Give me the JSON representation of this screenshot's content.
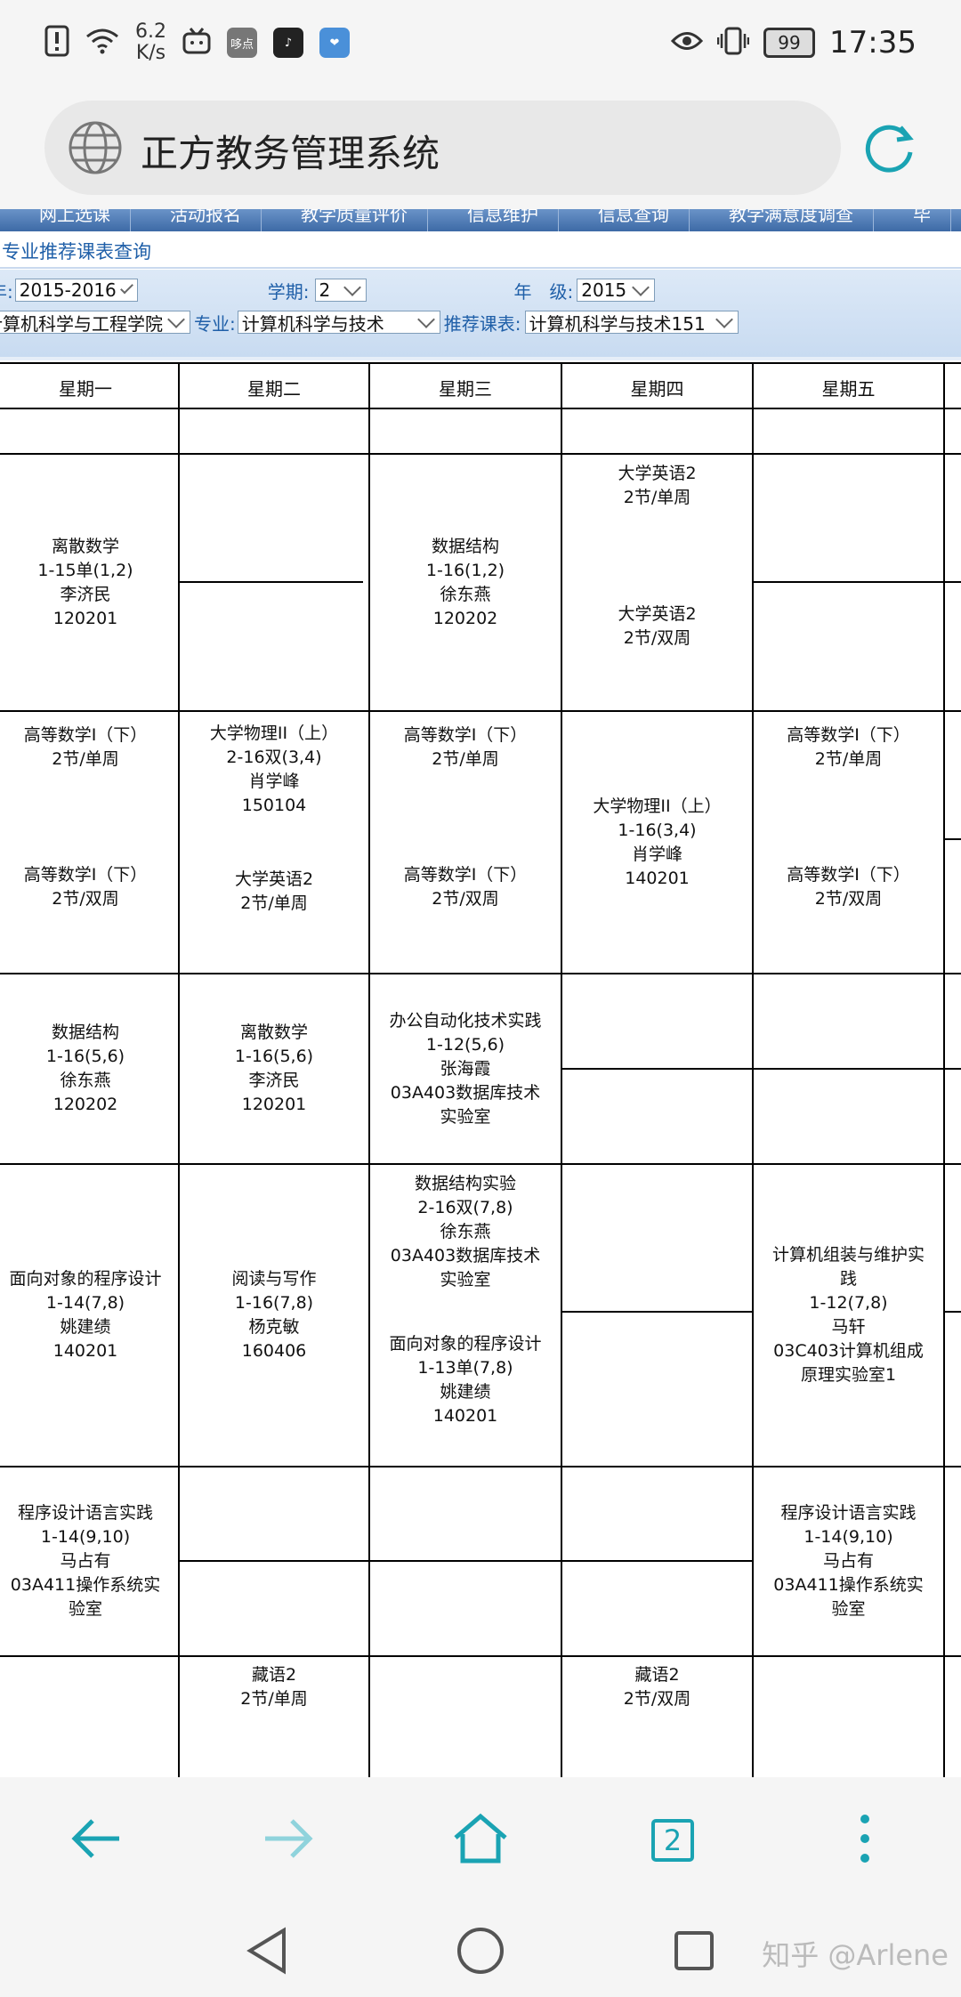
{
  "status_bar": {
    "net_speed_value": "6.2",
    "net_speed_unit": "K/s",
    "battery": "99",
    "time": "17:35",
    "app_icon_label": "哆点"
  },
  "browser": {
    "title": "正方教务管理系统",
    "tab_count": "2"
  },
  "nav_menu": [
    "网上选课",
    "活动报名",
    "教学质量评价",
    "信息维护",
    "信息查询",
    "教学满意度调查",
    "毕"
  ],
  "breadcrumb": "专业推荐课表查询",
  "filters": {
    "year_label": "年:",
    "year_value": "2015-2016",
    "semester_label": "学期:",
    "semester_value": "2",
    "grade_label": "年　级:",
    "grade_value": "2015",
    "college_value": "计算机科学与工程学院",
    "major_label": "专业:",
    "major_value": "计算机科学与技术",
    "recommend_label": "推荐课表:",
    "recommend_value": "计算机科学与技术151"
  },
  "timetable": {
    "days": [
      "星期一",
      "星期二",
      "星期三",
      "星期四",
      "星期五"
    ],
    "cells": [
      {
        "id": "mon-a",
        "lines": [
          "离散数学",
          "1-15单(1,2)",
          "李济民",
          "120201"
        ]
      },
      {
        "id": "wed-a",
        "lines": [
          "数据结构",
          "1-16(1,2)",
          "徐东燕",
          "120202"
        ]
      },
      {
        "id": "thu-a1",
        "lines": [
          "大学英语2",
          "2节/单周"
        ]
      },
      {
        "id": "thu-a2",
        "lines": [
          "大学英语2",
          "2节/双周"
        ]
      },
      {
        "id": "mon-b1",
        "lines": [
          "高等数学I（下）",
          "2节/单周"
        ]
      },
      {
        "id": "mon-b2",
        "lines": [
          "高等数学I（下）",
          "2节/双周"
        ]
      },
      {
        "id": "tue-b1",
        "lines": [
          "大学物理II（上）",
          "2-16双(3,4)",
          "肖学峰",
          "150104"
        ]
      },
      {
        "id": "tue-b2",
        "lines": [
          "大学英语2",
          "2节/单周"
        ]
      },
      {
        "id": "wed-b1",
        "lines": [
          "高等数学I（下）",
          "2节/单周"
        ]
      },
      {
        "id": "wed-b2",
        "lines": [
          "高等数学I（下）",
          "2节/双周"
        ]
      },
      {
        "id": "thu-b",
        "lines": [
          "大学物理II（上）",
          "1-16(3,4)",
          "肖学峰",
          "140201"
        ]
      },
      {
        "id": "fri-b1",
        "lines": [
          "高等数学I（下）",
          "2节/单周"
        ]
      },
      {
        "id": "fri-b2",
        "lines": [
          "高等数学I（下）",
          "2节/双周"
        ]
      },
      {
        "id": "mon-c",
        "lines": [
          "数据结构",
          "1-16(5,6)",
          "徐东燕",
          "120202"
        ]
      },
      {
        "id": "tue-c",
        "lines": [
          "离散数学",
          "1-16(5,6)",
          "李济民",
          "120201"
        ]
      },
      {
        "id": "wed-c",
        "lines": [
          "办公自动化技术实践",
          "1-12(5,6)",
          "张海霞",
          "03A403数据库技术",
          "实验室"
        ]
      },
      {
        "id": "mon-d",
        "lines": [
          "面向对象的程序设计",
          "1-14(7,8)",
          "姚建绩",
          "140201"
        ]
      },
      {
        "id": "tue-d",
        "lines": [
          "阅读与写作",
          "1-16(7,8)",
          "杨克敏",
          "160406"
        ]
      },
      {
        "id": "wed-d1",
        "lines": [
          "数据结构实验",
          "2-16双(7,8)",
          "徐东燕",
          "03A403数据库技术",
          "实验室"
        ]
      },
      {
        "id": "wed-d2",
        "lines": [
          "面向对象的程序设计",
          "1-13单(7,8)",
          "姚建绩",
          "140201"
        ]
      },
      {
        "id": "fri-d",
        "lines": [
          "计算机组装与维护实",
          "践",
          "1-12(7,8)",
          "马轩",
          "03C403计算机组成",
          "原理实验室1"
        ]
      },
      {
        "id": "mon-e",
        "lines": [
          "程序设计语言实践",
          "1-14(9,10)",
          "马占有",
          "03A411操作系统实",
          "验室"
        ]
      },
      {
        "id": "fri-e",
        "lines": [
          "程序设计语言实践",
          "1-14(9,10)",
          "马占有",
          "03A411操作系统实",
          "验室"
        ]
      },
      {
        "id": "tue-f",
        "lines": [
          "藏语2",
          "2节/单周"
        ]
      },
      {
        "id": "thu-f",
        "lines": [
          "藏语2",
          "2节/双周"
        ]
      }
    ]
  },
  "watermark": "知乎 @Arlene"
}
